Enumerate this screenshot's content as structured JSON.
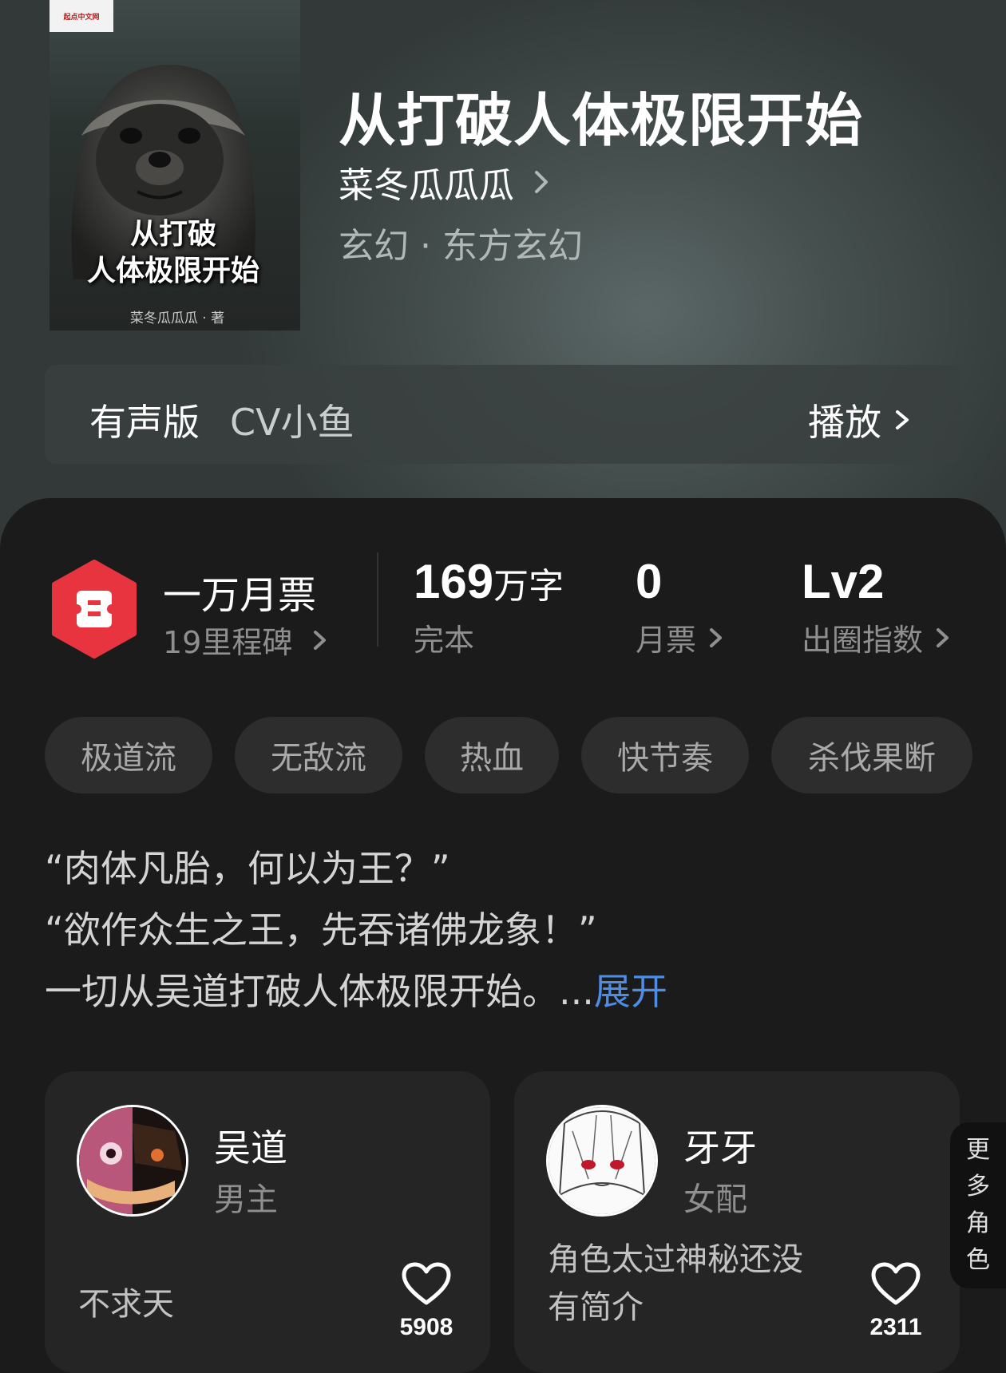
{
  "book": {
    "cover_logo": "起点中文网",
    "cover_title_line1": "从打破",
    "cover_title_line2": "人体极限开始",
    "cover_author": "菜冬瓜瓜瓜 · 著",
    "title": "从打破人体极限开始",
    "author": "菜冬瓜瓜瓜",
    "category": "玄幻 · 东方玄幻"
  },
  "audio": {
    "label": "有声版",
    "cv": "CV小鱼",
    "play_label": "播放"
  },
  "ticket": {
    "title": "一万月票",
    "subtitle": "19里程碑"
  },
  "stats": {
    "words_value": "169",
    "words_unit": "万字",
    "words_label": "完本",
    "monthly_value": "0",
    "monthly_label": "月票",
    "level_value": "Lv2",
    "level_label": "出圈指数"
  },
  "tags": [
    "极道流",
    "无敌流",
    "热血",
    "快节奏",
    "杀伐果断"
  ],
  "synopsis": {
    "line1": "“肉体凡胎，何以为王？”",
    "line2": "“欲作众生之王，先吞诸佛龙象！”",
    "line3": "一切从吴道打破人体极限开始。...",
    "expand": "展开"
  },
  "characters": [
    {
      "name": "吴道",
      "role": "男主",
      "desc": "不求天",
      "likes": "5908",
      "avatar_icon": "character-portrait-icon"
    },
    {
      "name": "牙牙",
      "role": "女配",
      "desc": "角色太过神秘还没有简介",
      "likes": "2311",
      "avatar_icon": "character-portrait-icon"
    }
  ],
  "more_roles": "更多角色",
  "colors": {
    "accent_link": "#4e8de6",
    "ticket_red": "#e8343f",
    "panel_bg": "#1b1b1b",
    "card_bg": "#252525"
  }
}
